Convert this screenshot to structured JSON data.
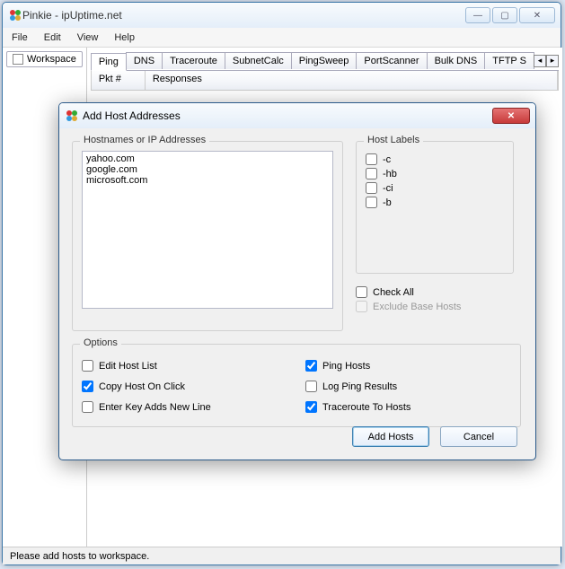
{
  "window": {
    "title": "Pinkie - ipUptime.net"
  },
  "menu": [
    "File",
    "Edit",
    "View",
    "Help"
  ],
  "sidebar": {
    "workspace_label": "Workspace"
  },
  "tabs": [
    "Ping",
    "DNS",
    "Traceroute",
    "SubnetCalc",
    "PingSweep",
    "PortScanner",
    "Bulk DNS",
    "TFTP S"
  ],
  "columns": {
    "pkt": "Pkt #",
    "responses": "Responses"
  },
  "status": "Please add hosts to workspace.",
  "dialog": {
    "title": "Add Host Addresses",
    "hosts_group": "Hostnames or IP Addresses",
    "hosts_text": "yahoo.com\ngoogle.com\nmicrosoft.com",
    "labels_group": "Host Labels",
    "labels": [
      "-c",
      "-hb",
      "-ci",
      "-b"
    ],
    "check_all": "Check All",
    "exclude": "Exclude Base Hosts",
    "options_group": "Options",
    "opt_edit": "Edit Host List",
    "opt_copy": "Copy Host On Click",
    "opt_enter": "Enter Key Adds New Line",
    "opt_ping": "Ping Hosts",
    "opt_log": "Log Ping Results",
    "opt_trace": "Traceroute To Hosts",
    "btn_add": "Add Hosts",
    "btn_cancel": "Cancel"
  }
}
